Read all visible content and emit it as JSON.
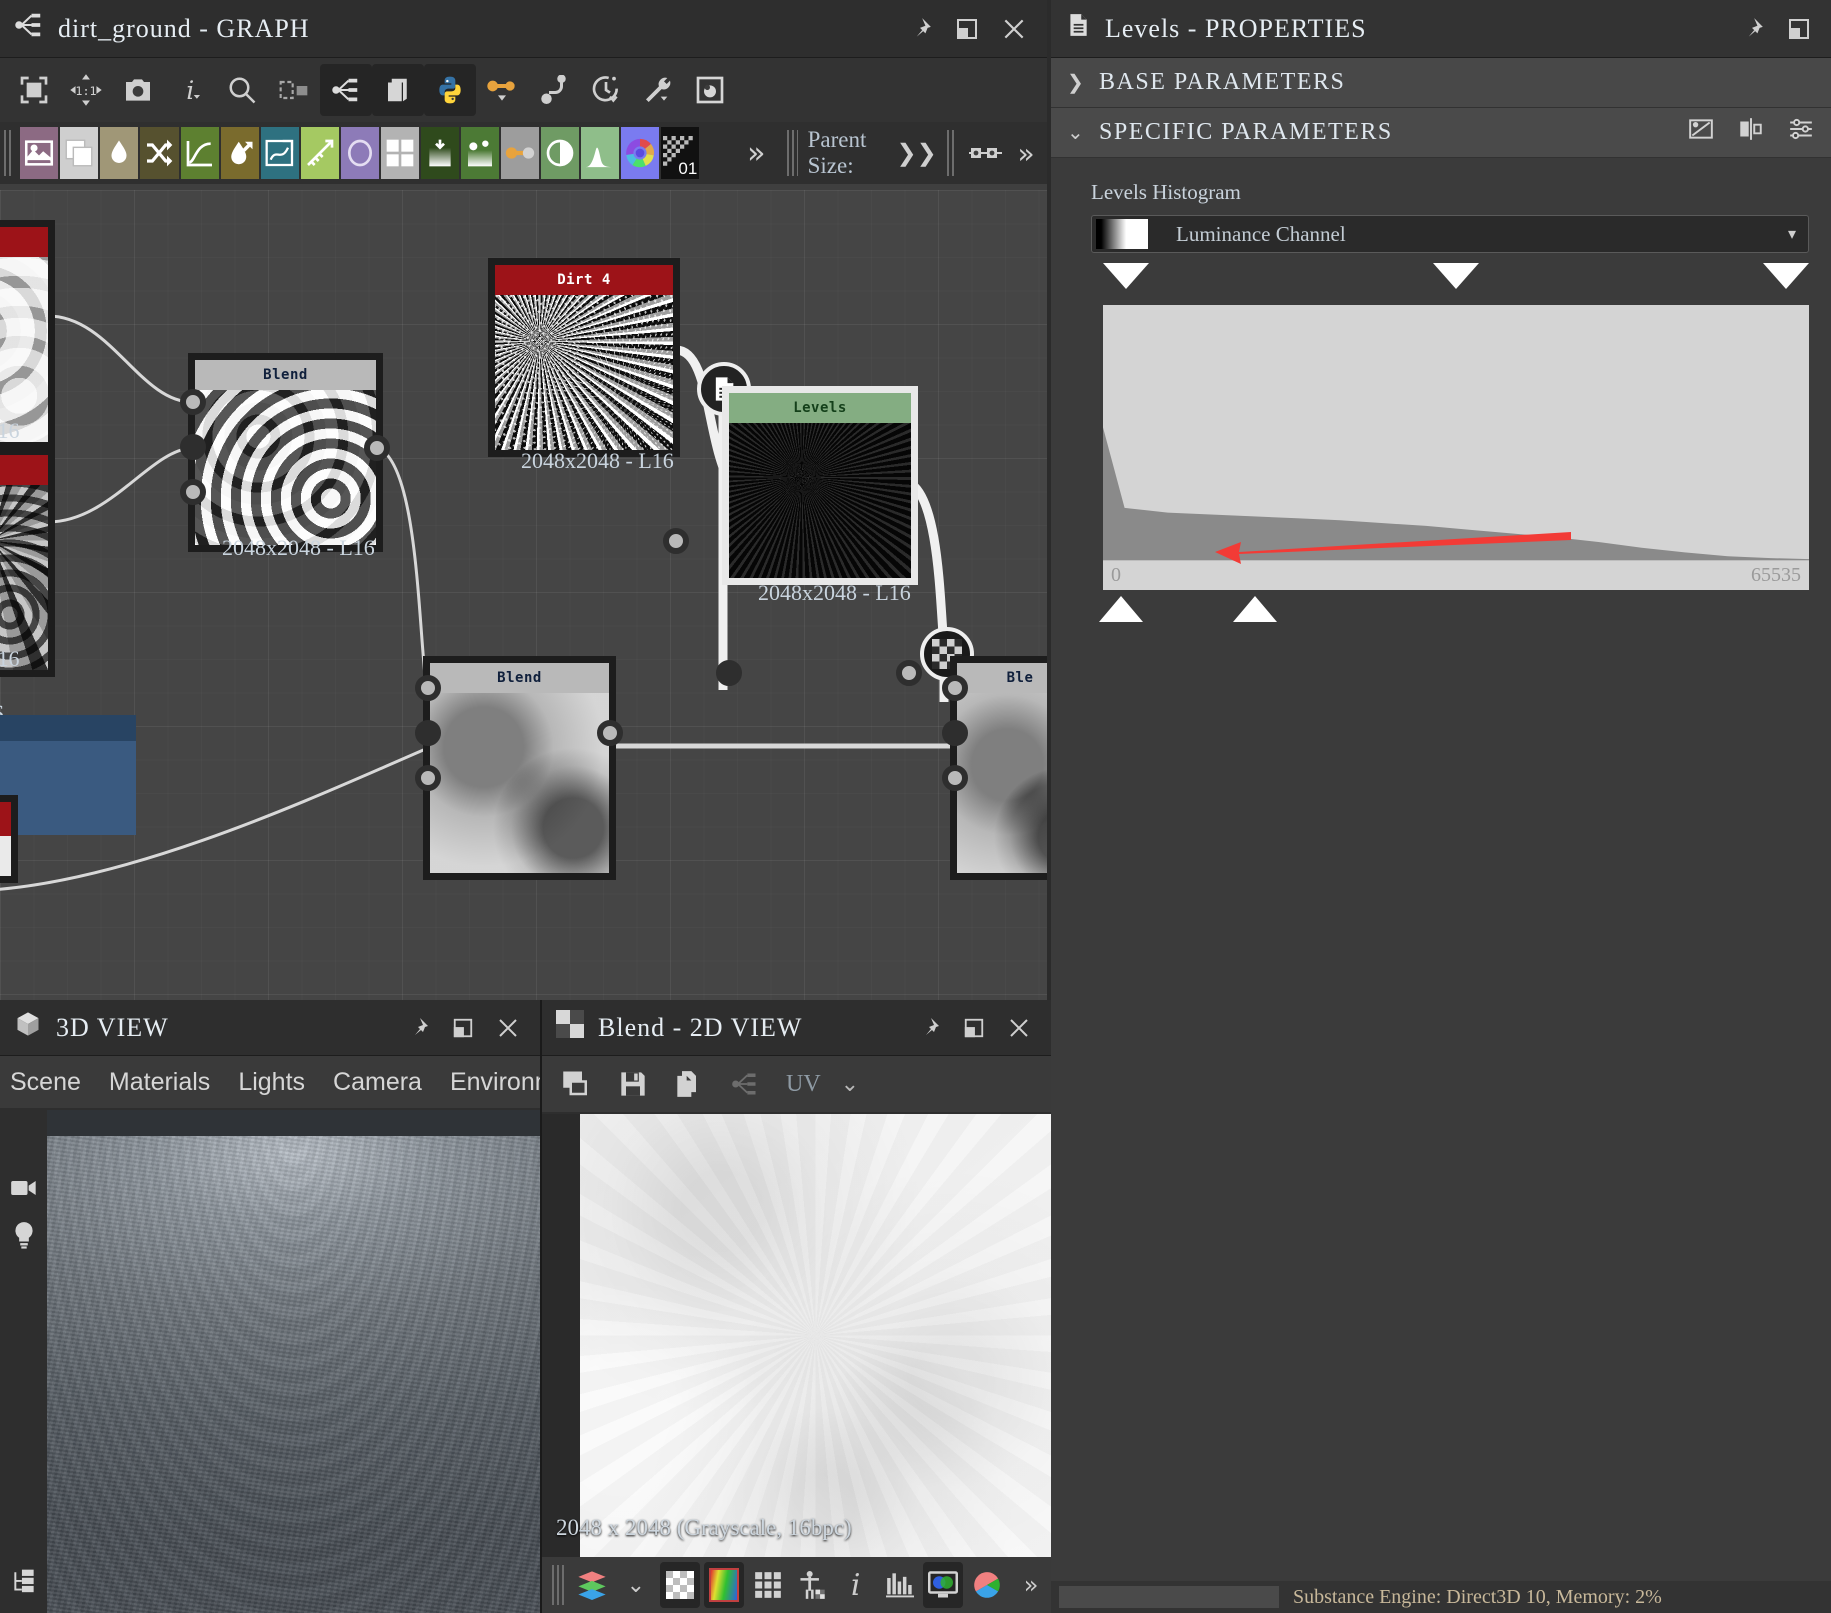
{
  "graph": {
    "title": "dirt_ground - GRAPH",
    "icon": "graph-icon",
    "toolbar": [
      {
        "name": "fit-view-icon",
        "glyph": "⬚"
      },
      {
        "name": "zoom-1-1-icon",
        "glyph": "1:1"
      },
      {
        "name": "screenshot-icon",
        "glyph": "◙"
      },
      {
        "name": "info-icon",
        "glyph": "i"
      },
      {
        "name": "search-icon",
        "glyph": "⌕"
      },
      {
        "name": "align-nodes-icon",
        "glyph": "▭"
      },
      {
        "name": "graph-node-icon",
        "glyph": "⋔"
      },
      {
        "name": "duplicate-icon",
        "glyph": "❐"
      },
      {
        "name": "python-icon",
        "glyph": "🐍"
      },
      {
        "name": "link-icon",
        "glyph": "⊶"
      },
      {
        "name": "connector-icon",
        "glyph": "⌐"
      },
      {
        "name": "timer-icon",
        "glyph": "◷"
      },
      {
        "name": "wrench-icon",
        "glyph": "🔧"
      },
      {
        "name": "preview-icon",
        "glyph": "▣"
      }
    ],
    "overflow_label": "»",
    "parent_size_label": "Parent Size:",
    "parent_size_caret": "❯❯",
    "library": [
      {
        "name": "bitmap-icon",
        "color": "#8c6a83"
      },
      {
        "name": "svg-icon",
        "color": "#cfcfcf"
      },
      {
        "name": "water-level-icon",
        "color": "#a09777"
      },
      {
        "name": "shuffle-icon",
        "color": "#56512f"
      },
      {
        "name": "curve-icon",
        "color": "#5d8030"
      },
      {
        "name": "blur-hq-icon",
        "color": "#7a6b2d"
      },
      {
        "name": "warp-icon",
        "color": "#2e7180"
      },
      {
        "name": "slope-blur-icon",
        "color": "#a5c962"
      },
      {
        "name": "shape-icon",
        "color": "#8d7bb8"
      },
      {
        "name": "tile-generator-icon",
        "color": "#b3b3b3"
      },
      {
        "name": "gradient-map-icon",
        "color": "#2f4a1c"
      },
      {
        "name": "splatter-icon",
        "color": "#4c7a35"
      },
      {
        "name": "transform-icon",
        "color": "#9d9d9d"
      },
      {
        "name": "contrast-icon",
        "color": "#6f9b64"
      },
      {
        "name": "histogram-icon",
        "color": "#8fbe8a"
      },
      {
        "name": "hsl-icon",
        "color": "#7a7bf0"
      },
      {
        "name": "checker-01-icon",
        "color": "#111111",
        "label": "01"
      }
    ],
    "nodes": [
      {
        "name": "node-left-top",
        "title": "",
        "header": "red",
        "info": "16",
        "partial": true
      },
      {
        "name": "node-left-bottom",
        "title": "",
        "header": "red",
        "info": "16",
        "partial": true
      },
      {
        "name": "node-blend-1",
        "title": "Blend",
        "header": "grey",
        "info": "2048x2048 - L16"
      },
      {
        "name": "node-dirt-4",
        "title": "Dirt 4",
        "header": "red",
        "info": "2048x2048 - L16"
      },
      {
        "name": "node-levels",
        "title": "Levels",
        "header": "green",
        "info": "2048x2048 - L16"
      },
      {
        "name": "node-blend-2",
        "title": "Blend",
        "header": "grey",
        "info": ""
      },
      {
        "name": "node-blend-3",
        "title": "Ble",
        "header": "grey",
        "info": ""
      }
    ]
  },
  "properties": {
    "title": "Levels - PROPERTIES",
    "icon": "document-properties-icon",
    "sections": [
      {
        "name": "base-parameters",
        "label": "BASE PARAMETERS",
        "expanded": false,
        "chevron": "❯"
      },
      {
        "name": "specific-parameters",
        "label": "SPECIFIC PARAMETERS",
        "expanded": true,
        "chevron": "⌄"
      }
    ],
    "header_icons": [
      "link-params-icon",
      "mirror-params-icon",
      "settings-sliders-icon"
    ],
    "histogram_label": "Levels Histogram",
    "channel_value": "Luminance Channel",
    "channel_caret": "▾",
    "axis_min": "0",
    "axis_max": "65535",
    "annotation": {
      "name": "red-arrow-annotation",
      "color": "#f23b36"
    }
  },
  "chart_data": {
    "type": "area",
    "title": "Levels Histogram",
    "xlabel": "",
    "ylabel": "",
    "xlim": [
      0,
      65535
    ],
    "grid": false,
    "legend": "none",
    "tick_labels": [
      "0",
      "65535"
    ],
    "x": [
      0,
      2000,
      6000,
      10000,
      14000,
      18000,
      22000,
      26000,
      30000,
      34000,
      38000,
      42000,
      46000,
      50000,
      54000,
      58000,
      62000,
      65535
    ],
    "values": [
      0.14,
      0.055,
      0.05,
      0.048,
      0.046,
      0.044,
      0.042,
      0.039,
      0.036,
      0.032,
      0.028,
      0.024,
      0.019,
      0.013,
      0.008,
      0.004,
      0.002,
      0.001
    ],
    "series": [
      {
        "name": "Luminance Channel",
        "values": [
          0.14,
          0.055,
          0.05,
          0.048,
          0.046,
          0.044,
          0.042,
          0.039,
          0.036,
          0.032,
          0.028,
          0.024,
          0.019,
          0.013,
          0.008,
          0.004,
          0.002,
          0.001
        ]
      }
    ],
    "markers": {
      "black_point": 0,
      "mid_point": 0.2,
      "white_point": 1.0
    }
  },
  "view3d": {
    "title": "3D VIEW",
    "icon": "cube-icon",
    "menu": [
      "Scene",
      "Materials",
      "Lights",
      "Camera",
      "Environment"
    ],
    "menu_overflow": "»",
    "side_icons": [
      "camera-icon",
      "light-icon",
      "hierarchy-icon"
    ]
  },
  "view2d": {
    "title": "Blend - 2D VIEW",
    "icon": "checker-icon",
    "toolbar": [
      {
        "name": "copy-view-icon"
      },
      {
        "name": "save-icon"
      },
      {
        "name": "duplicate-icon"
      },
      {
        "name": "graph-link-icon"
      },
      {
        "name": "uv-label",
        "label": "UV"
      },
      {
        "name": "uv-caret",
        "label": "⌄"
      }
    ],
    "status": "2048 x 2048 (Grayscale, 16bpc)",
    "bottom_toolbar": [
      {
        "name": "layers-icon"
      },
      {
        "name": "layers-caret-icon",
        "label": "⌄"
      },
      {
        "name": "alpha-checker-icon",
        "selected": true
      },
      {
        "name": "rgb-gradient-icon",
        "selected": true
      },
      {
        "name": "tiling-grid-icon"
      },
      {
        "name": "human-scale-icon"
      },
      {
        "name": "info-icon",
        "label": "i"
      },
      {
        "name": "histogram-icon"
      },
      {
        "name": "channels-icon",
        "selected": true
      },
      {
        "name": "color-wheel-icon"
      },
      {
        "name": "overflow-icon",
        "label": "»"
      }
    ]
  },
  "statusbar": {
    "text": "Substance Engine: Direct3D 10, Memory: 2%"
  },
  "window_buttons": [
    "pin-icon",
    "maximize-icon",
    "close-icon"
  ]
}
